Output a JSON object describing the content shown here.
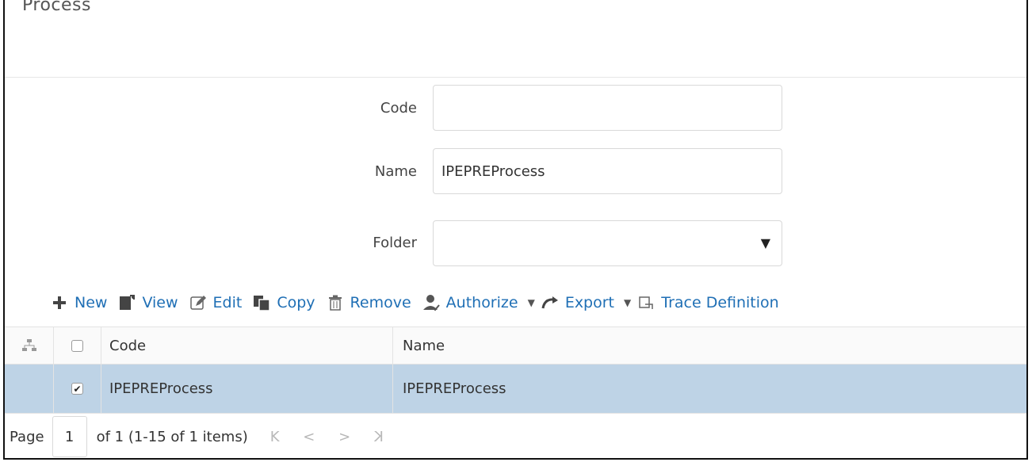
{
  "page": {
    "title": "Process"
  },
  "form": {
    "code": {
      "label": "Code",
      "value": "",
      "placeholder": ""
    },
    "name": {
      "label": "Name",
      "value": "IPEPREProcess",
      "placeholder": ""
    },
    "folder": {
      "label": "Folder",
      "value": ""
    }
  },
  "toolbar": {
    "new_label": "New",
    "view_label": "View",
    "edit_label": "Edit",
    "copy_label": "Copy",
    "remove_label": "Remove",
    "authorize_label": "Authorize",
    "export_label": "Export",
    "trace_label": "Trace Definition"
  },
  "grid": {
    "columns": {
      "code": "Code",
      "name": "Name"
    },
    "rows": [
      {
        "code": "IPEPREProcess",
        "name": "IPEPREProcess",
        "checked": true
      }
    ]
  },
  "pager": {
    "page_label": "Page",
    "page_value": "1",
    "info": "of 1  (1-15 of  1 items)",
    "first": "K",
    "prev": "<",
    "next": ">",
    "last": "K"
  },
  "colors": {
    "accent": "#1f6fb5",
    "selected_row": "#bed3e6"
  }
}
